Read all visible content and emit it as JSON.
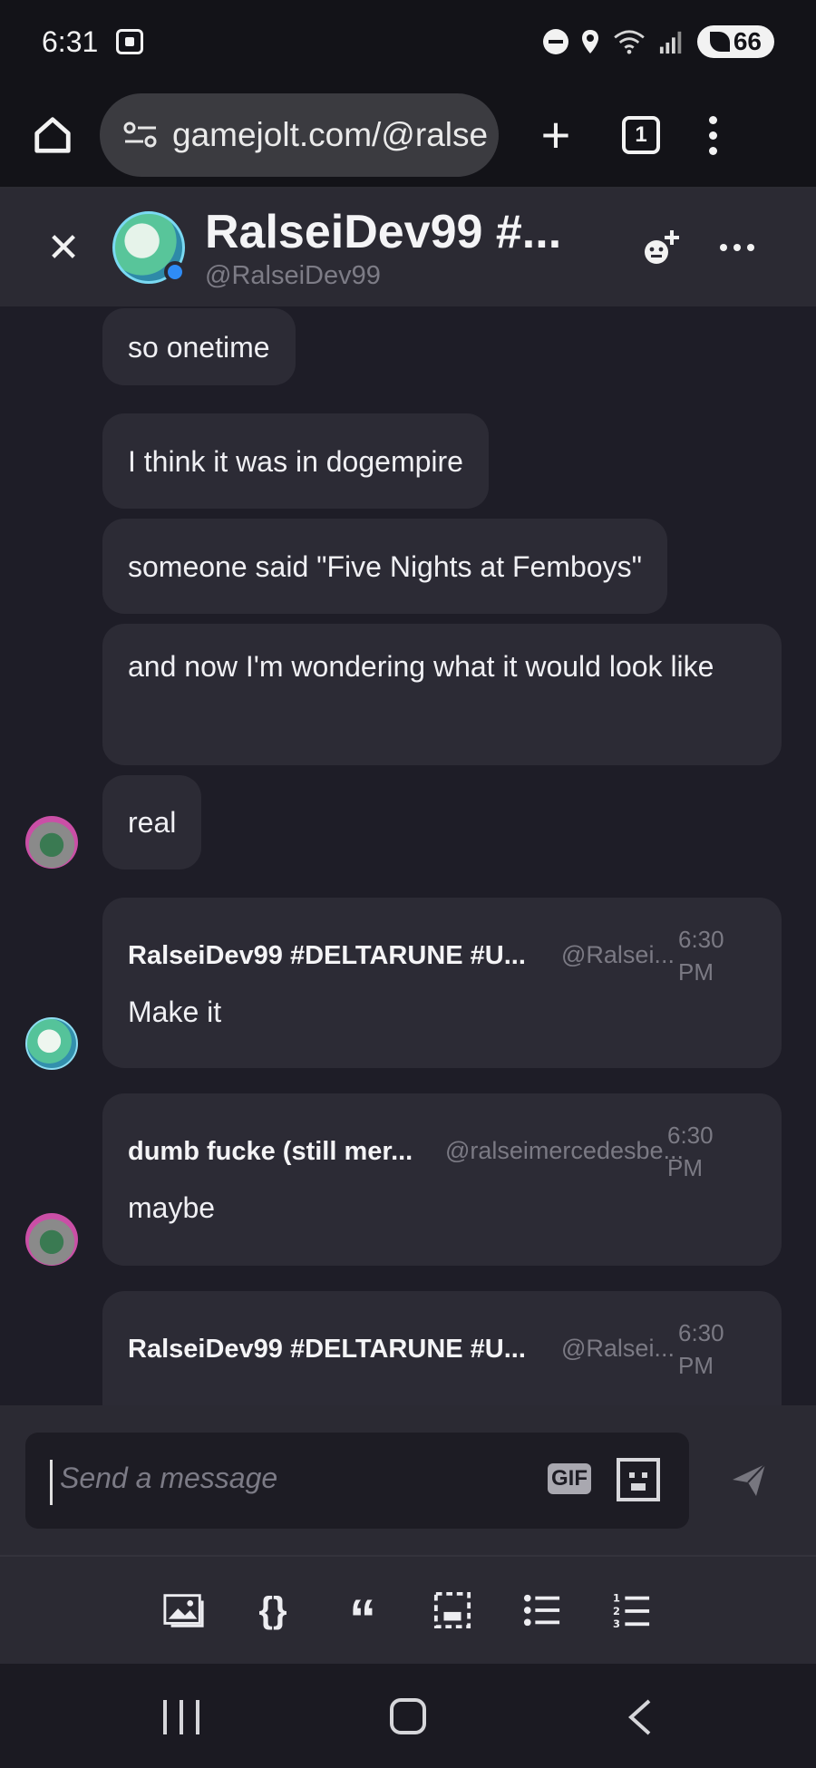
{
  "status_bar": {
    "time": "6:31",
    "battery": "66",
    "icons": [
      "screenshot-icon",
      "dnd-icon",
      "location-icon",
      "wifi-icon",
      "signal-icon",
      "battery-icon"
    ]
  },
  "browser": {
    "url": "gamejolt.com/@ralse",
    "tab_count": "1"
  },
  "chat_header": {
    "name": "RalseiDev99 #...",
    "handle": "@RalseiDev99"
  },
  "messages": {
    "m1": "so onetime",
    "m2": "I think it was in dogempire",
    "m3": "someone said \"Five Nights at Femboys\"",
    "m4": "and now I'm wondering what it would look like",
    "m5": "real",
    "card1": {
      "name": "RalseiDev99 #DELTARUNE #U...",
      "handle": "@Ralsei...",
      "time": "6:30 PM",
      "text": "Make it"
    },
    "card2": {
      "name": "dumb fucke (still mer...",
      "handle": "@ralseimercedesbe...",
      "time": "6:30 PM",
      "text": "maybe"
    },
    "card3": {
      "name": "RalseiDev99 #DELTARUNE #U...",
      "handle": "@Ralsei...",
      "time": "6:30 PM",
      "text": ""
    }
  },
  "composer": {
    "placeholder": "Send a message",
    "gif_label": "GIF"
  },
  "colors": {
    "background": "#1e1d27",
    "bubble": "#2c2b35",
    "header": "#2b2a33",
    "online": "#2f8cf5"
  }
}
